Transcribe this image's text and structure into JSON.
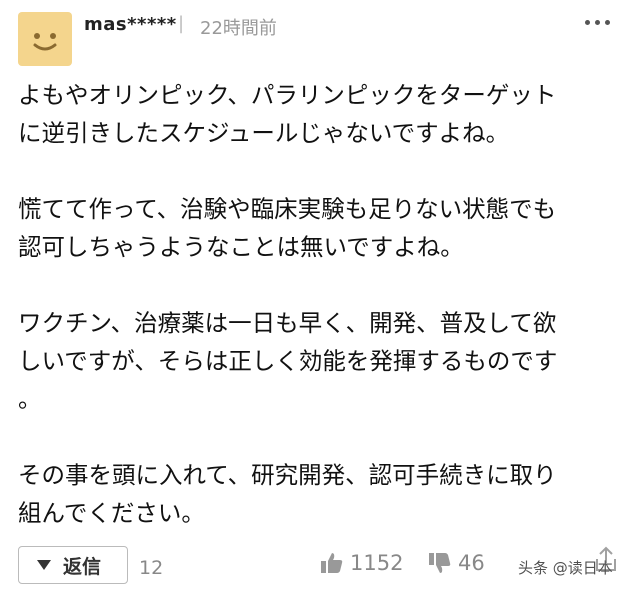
{
  "header": {
    "username": "mas*****",
    "separator": "|",
    "timestamp": "22時間前",
    "more_icon": "more-horizontal-icon"
  },
  "avatar": {
    "icon": "smiley-face-icon",
    "color": "#f4d58d"
  },
  "comment": {
    "paragraphs": [
      "よもやオリンピック、パラリンピックをターゲット\nに逆引きしたスケジュールじゃないですよね。",
      "慌てて作って、治験や臨床実験も足りない状態でも\n認可しちゃうようなことは無いですよね。",
      "ワクチン、治療薬は一日も早く、開発、普及して欲\nしいですが、そらは正しく効能を発揮するものです\n。",
      "その事を頭に入れて、研究開発、認可手続きに取り\n組んでください。"
    ]
  },
  "footer": {
    "reply_label": "返信",
    "reply_count": "12",
    "like_count": "1152",
    "dislike_count": "46",
    "watermark": "头条 @读日本"
  }
}
